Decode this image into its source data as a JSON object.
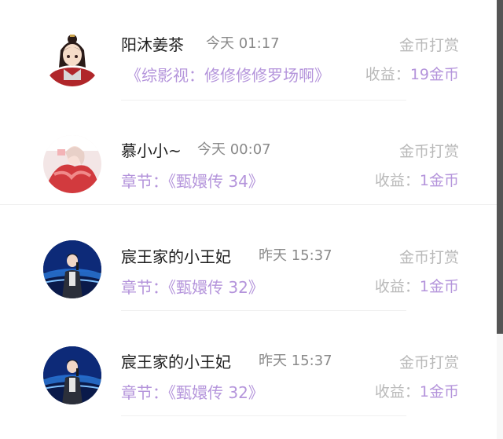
{
  "items": [
    {
      "avatar": "avatar-anime-girl",
      "name": "阳沐姜茶",
      "time": "今天 01:17",
      "reward_label": "金币打赏",
      "chapter_label": "",
      "work": "《综影视：修修修修罗场啊》",
      "income_label": "收益：",
      "income_value": "19金币"
    },
    {
      "avatar": "avatar-red-dress-girl",
      "name": "慕小小~",
      "time": "今天 00:07",
      "reward_label": "金币打赏",
      "chapter_label": "章节：",
      "work": "《甄嬛传 34》",
      "income_label": "收益：",
      "income_value": "1金币"
    },
    {
      "avatar": "avatar-stage-singer",
      "name": "宸王家的小王妃",
      "time": "昨天 15:37",
      "reward_label": "金币打赏",
      "chapter_label": "章节：",
      "work": "《甄嬛传 32》",
      "income_label": "收益：",
      "income_value": "1金币"
    },
    {
      "avatar": "avatar-stage-singer",
      "name": "宸王家的小王妃",
      "time": "昨天 15:37",
      "reward_label": "金币打赏",
      "chapter_label": "章节：",
      "work": "《甄嬛传 32》",
      "income_label": "收益：",
      "income_value": "1金币"
    }
  ],
  "colors": {
    "accent_purple": "#b494db",
    "name_text": "#1f1f1f",
    "time_text": "#8a8a8a",
    "muted_text": "#b9b9b9",
    "scrollbar": "#555555"
  }
}
